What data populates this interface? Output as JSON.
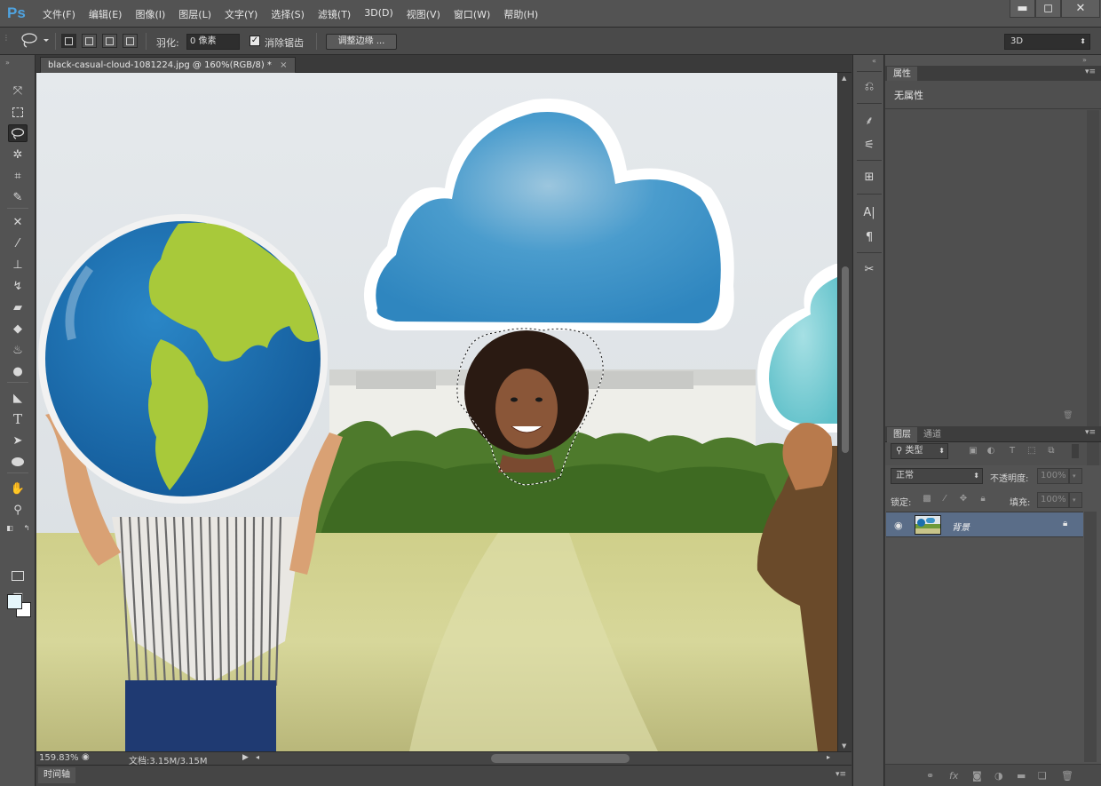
{
  "app": {
    "logo": "Ps",
    "menu": [
      "文件(F)",
      "编辑(E)",
      "图像(I)",
      "图层(L)",
      "文字(Y)",
      "选择(S)",
      "滤镜(T)",
      "3D(D)",
      "视图(V)",
      "窗口(W)",
      "帮助(H)"
    ],
    "window_controls": {
      "minimize": "▬",
      "maximize": "◻",
      "close": "✕"
    }
  },
  "options": {
    "feather_label": "羽化:",
    "feather_value": "0 像素",
    "antialias_label": "消除锯齿",
    "antialias_checked": true,
    "refine_edge_label": "调整边缘 ...",
    "workspace": "3D"
  },
  "document": {
    "tab_title": "black-casual-cloud-1081224.jpg @ 160%(RGB/8) *",
    "tab_close": "×",
    "zoom": "159.83%",
    "doc_size": "文档:3.15M/3.15M"
  },
  "tools": [
    "move-tool",
    "marquee-tool",
    "lasso-tool",
    "magic-wand-tool",
    "crop-tool",
    "eyedropper-tool",
    "healing-tool",
    "brush-tool",
    "stamp-tool",
    "history-brush-tool",
    "eraser-tool",
    "paint-bucket-tool",
    "blur-tool",
    "dodge-tool",
    "pen-tool",
    "type-tool",
    "path-select-tool",
    "shape-tool",
    "hand-tool",
    "zoom-tool"
  ],
  "colors": {
    "foreground": "#e6f6fb",
    "background": "#ffffff",
    "accent": "#5a6d88"
  },
  "panels": {
    "properties": {
      "tab": "属性",
      "content": "无属性"
    },
    "layers": {
      "tabs": [
        "图层",
        "通道"
      ],
      "filter_kind": "类型",
      "blend_mode": "正常",
      "opacity_label": "不透明度:",
      "opacity_value": "100%",
      "lock_label": "锁定:",
      "fill_label": "填充:",
      "fill_value": "100%",
      "items": [
        {
          "name": "背景",
          "visible": true,
          "locked": true
        }
      ]
    }
  },
  "timeline": {
    "tab": "时间轴"
  }
}
